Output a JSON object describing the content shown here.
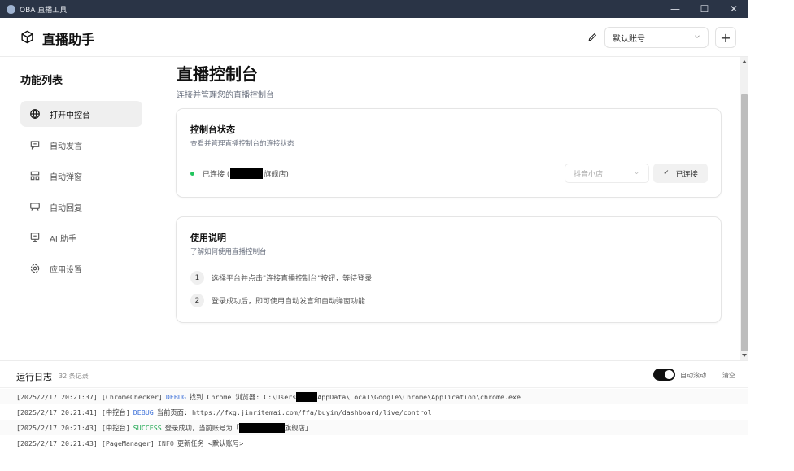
{
  "window": {
    "title": "OBA 直播工具",
    "controls": [
      "—",
      "☐",
      "✕"
    ]
  },
  "header": {
    "brand": "直播助手",
    "account_selected": "默认账号",
    "add_label": "+"
  },
  "sidebar": {
    "title": "功能列表",
    "items": [
      {
        "label": "打开中控台",
        "icon": "globe-icon",
        "active": true
      },
      {
        "label": "自动发言",
        "icon": "message-icon",
        "active": false
      },
      {
        "label": "自动弹窗",
        "icon": "grid-icon",
        "active": false
      },
      {
        "label": "自动回复",
        "icon": "reply-icon",
        "active": false
      },
      {
        "label": "AI 助手",
        "icon": "monitor-icon",
        "active": false
      },
      {
        "label": "应用设置",
        "icon": "gear-icon",
        "active": false
      }
    ]
  },
  "main": {
    "title": "直播控制台",
    "subtitle": "连接并管理您的直播控制台",
    "status_card": {
      "title": "控制台状态",
      "subtitle": "查看并管理直播控制台的连接状态",
      "status_prefix": "已连接 (",
      "status_suffix": "旗舰店)",
      "platform": "抖音小店",
      "connected_label": "已连接",
      "status_color": "#22c55e"
    },
    "help_card": {
      "title": "使用说明",
      "subtitle": "了解如何使用直播控制台",
      "steps": [
        {
          "num": "1",
          "text": "选择平台并点击\"连接直播控制台\"按钮，等待登录"
        },
        {
          "num": "2",
          "text": "登录成功后，即可使用自动发言和自动弹窗功能"
        }
      ]
    }
  },
  "log": {
    "title": "运行日志",
    "count": "32 条记录",
    "autoscroll_label": "自动滚动",
    "clear_label": "清空",
    "lines": [
      {
        "time": "[2025/2/17 20:21:37]",
        "source": "[ChromeChecker]",
        "level": "DEBUG",
        "msg_a": "找到 Chrome 浏览器: C:\\Users",
        "msg_b": "AppData\\Local\\Google\\Chrome\\Application\\chrome.exe"
      },
      {
        "time": "[2025/2/17 20:21:41]",
        "source": "[中控台]",
        "level": "DEBUG",
        "msg_a": "当前页面: https://fxg.jinritemai.com/ffa/buyin/dashboard/live/control",
        "msg_b": ""
      },
      {
        "time": "[2025/2/17 20:21:43]",
        "source": "[中控台]",
        "level": "SUCCESS",
        "msg_a": "登录成功，当前账号为「",
        "msg_b": "旗舰店」"
      },
      {
        "time": "[2025/2/17 20:21:43]",
        "source": "[PageManager]",
        "level": "INFO",
        "msg_a": "更新任务 <默认账号>",
        "msg_b": ""
      }
    ]
  }
}
